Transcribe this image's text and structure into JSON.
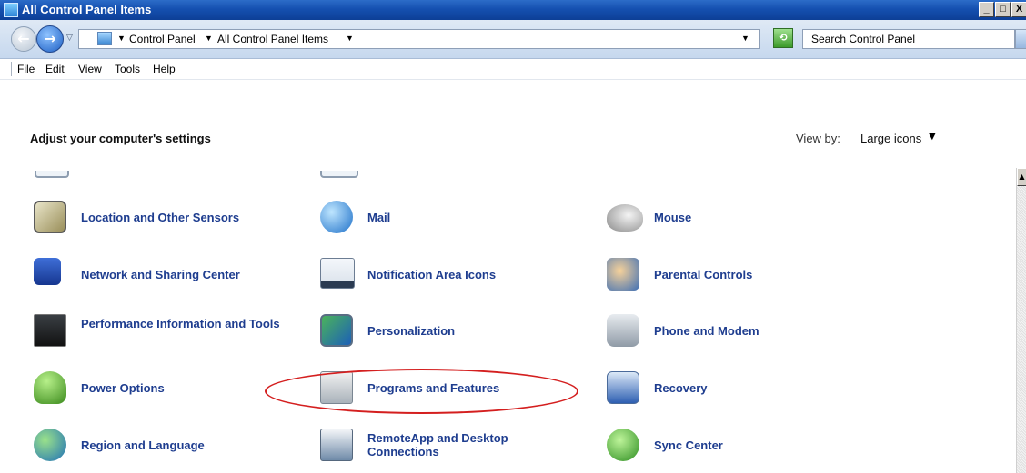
{
  "window": {
    "title": "All Control Panel Items",
    "minimize": "_",
    "maximize": "□",
    "close": "X"
  },
  "address": {
    "crumbs": [
      "Control Panel",
      "All Control Panel Items"
    ],
    "separator": "▸",
    "search_placeholder": "Search Control Panel"
  },
  "menu": {
    "items": [
      "File",
      "Edit",
      "View",
      "Tools",
      "Help"
    ]
  },
  "content": {
    "heading": "Adjust your computer's settings",
    "view_by_label": "View by:",
    "view_by_value": "Large icons",
    "items": [
      {
        "label": "Location and Other Sensors",
        "icon": "location-sensors-icon"
      },
      {
        "label": "Mail",
        "icon": "mail-icon"
      },
      {
        "label": "Mouse",
        "icon": "mouse-icon"
      },
      {
        "label": "Network and Sharing Center",
        "icon": "network-icon"
      },
      {
        "label": "Notification Area Icons",
        "icon": "notification-area-icon"
      },
      {
        "label": "Parental Controls",
        "icon": "parental-controls-icon"
      },
      {
        "label": "Performance Information and Tools",
        "icon": "performance-icon"
      },
      {
        "label": "Personalization",
        "icon": "personalization-icon"
      },
      {
        "label": "Phone and Modem",
        "icon": "phone-modem-icon"
      },
      {
        "label": "Power Options",
        "icon": "power-options-icon"
      },
      {
        "label": "Programs and Features",
        "icon": "programs-features-icon"
      },
      {
        "label": "Recovery",
        "icon": "recovery-icon"
      },
      {
        "label": "Region and Language",
        "icon": "region-language-icon"
      },
      {
        "label": "RemoteApp and Desktop Connections",
        "icon": "remoteapp-icon"
      },
      {
        "label": "Sync Center",
        "icon": "sync-center-icon"
      }
    ]
  },
  "colors": {
    "link": "#1e3d8f",
    "title_bar": "#1550b0",
    "highlight": "#d41f1f"
  }
}
